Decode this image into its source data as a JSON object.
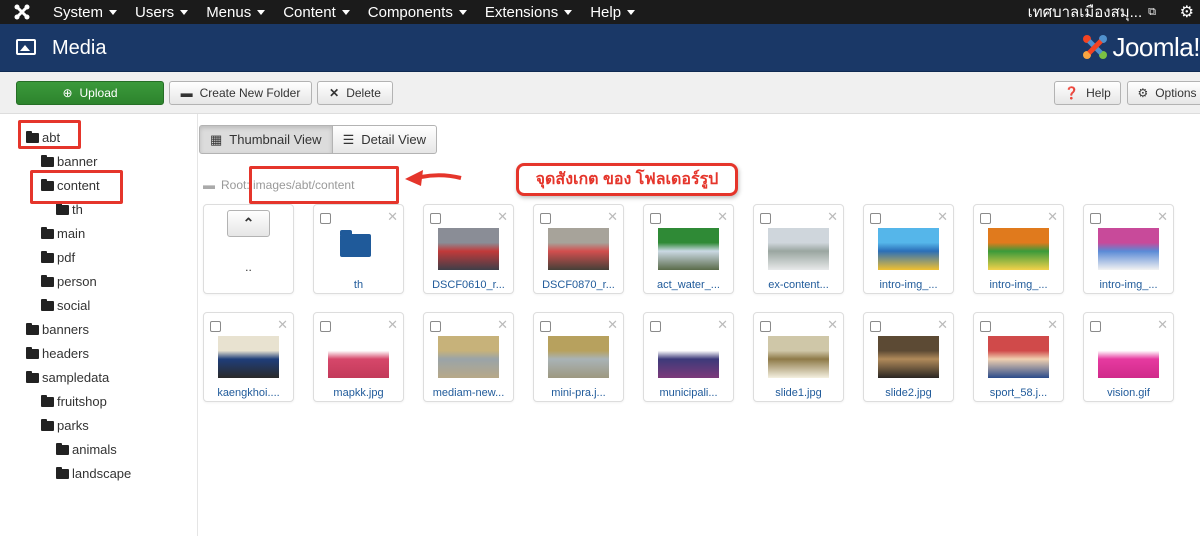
{
  "topnav": {
    "menus": [
      "System",
      "Users",
      "Menus",
      "Content",
      "Components",
      "Extensions",
      "Help"
    ],
    "site_name": "เทศบาลเมืองสมุ...",
    "settings_icon": "gear-icon"
  },
  "header": {
    "title": "Media",
    "brand": "Joomla!"
  },
  "toolbar": {
    "upload": "Upload",
    "create_folder": "Create New Folder",
    "delete": "Delete",
    "help": "Help",
    "options": "Options"
  },
  "tree": {
    "items": [
      {
        "label": "abt",
        "level": 0
      },
      {
        "label": "banner",
        "level": 1
      },
      {
        "label": "content",
        "level": 1
      },
      {
        "label": "th",
        "level": 2
      },
      {
        "label": "main",
        "level": 1
      },
      {
        "label": "pdf",
        "level": 1
      },
      {
        "label": "person",
        "level": 1
      },
      {
        "label": "social",
        "level": 1
      },
      {
        "label": "banners",
        "level": 0
      },
      {
        "label": "headers",
        "level": 0
      },
      {
        "label": "sampledata",
        "level": 0
      },
      {
        "label": "fruitshop",
        "level": 1
      },
      {
        "label": "parks",
        "level": 1
      },
      {
        "label": "animals",
        "level": 2
      },
      {
        "label": "landscape",
        "level": 2
      }
    ]
  },
  "view": {
    "thumbnail": "Thumbnail View",
    "detail": "Detail View"
  },
  "path": "Root: images/abt/content",
  "up_label": "..",
  "files_row1": [
    {
      "name": "th",
      "kind": "folder"
    },
    {
      "name": "DSCF0610_r...",
      "kind": "image",
      "colors": [
        "#8a8d96",
        "#c23a3a",
        "#3e3e48"
      ]
    },
    {
      "name": "DSCF0870_r...",
      "kind": "image",
      "colors": [
        "#a7a39a",
        "#d24f4f",
        "#454038"
      ]
    },
    {
      "name": "act_water_...",
      "kind": "image",
      "colors": [
        "#2f8a36",
        "#cbd9e4",
        "#5a6b4a"
      ]
    },
    {
      "name": "ex-content...",
      "kind": "image",
      "colors": [
        "#cfd6dc",
        "#9aa6a0",
        "#e7e9ea"
      ]
    },
    {
      "name": "intro-img_...",
      "kind": "image",
      "colors": [
        "#55b6ea",
        "#2b6fb8",
        "#f0c030"
      ]
    },
    {
      "name": "intro-img_...",
      "kind": "image",
      "colors": [
        "#e07a1d",
        "#3a9a3a",
        "#f2d24a"
      ]
    },
    {
      "name": "intro-img_...",
      "kind": "image",
      "colors": [
        "#c84a9a",
        "#5a8ad6",
        "#f2f2f2"
      ]
    }
  ],
  "files_row2": [
    {
      "name": "kaengkhoi....",
      "kind": "image",
      "colors": [
        "#e8e2d0",
        "#1f3e7a",
        "#2a2a2a"
      ]
    },
    {
      "name": "mapkk.jpg",
      "kind": "image",
      "colors": [
        "#ffffff",
        "#d6476a",
        "#c33a5a"
      ]
    },
    {
      "name": "mediam-new...",
      "kind": "image",
      "colors": [
        "#c7b27a",
        "#9aa4a8",
        "#b7a888"
      ]
    },
    {
      "name": "mini-pra.j...",
      "kind": "image",
      "colors": [
        "#b7a15e",
        "#a9b3b6",
        "#9d9880"
      ]
    },
    {
      "name": "municipali...",
      "kind": "image",
      "colors": [
        "#ffffff",
        "#3d3a7a",
        "#7c3a7a"
      ]
    },
    {
      "name": "slide1.jpg",
      "kind": "image",
      "colors": [
        "#cfc7a8",
        "#8e7a48",
        "#f4f0e0"
      ]
    },
    {
      "name": "slide2.jpg",
      "kind": "image",
      "colors": [
        "#5c4a34",
        "#b08a5a",
        "#2a2622"
      ]
    },
    {
      "name": "sport_58.j...",
      "kind": "image",
      "colors": [
        "#d04a4a",
        "#f0d0b0",
        "#2a4a8a"
      ]
    },
    {
      "name": "vision.gif",
      "kind": "image",
      "colors": [
        "#ffffff",
        "#e63aa0",
        "#d02a8a"
      ]
    }
  ],
  "annotation": {
    "callout_text": "จุดสังเกต ของ โฟลเดอร์รูป",
    "color": "#e5352b"
  }
}
